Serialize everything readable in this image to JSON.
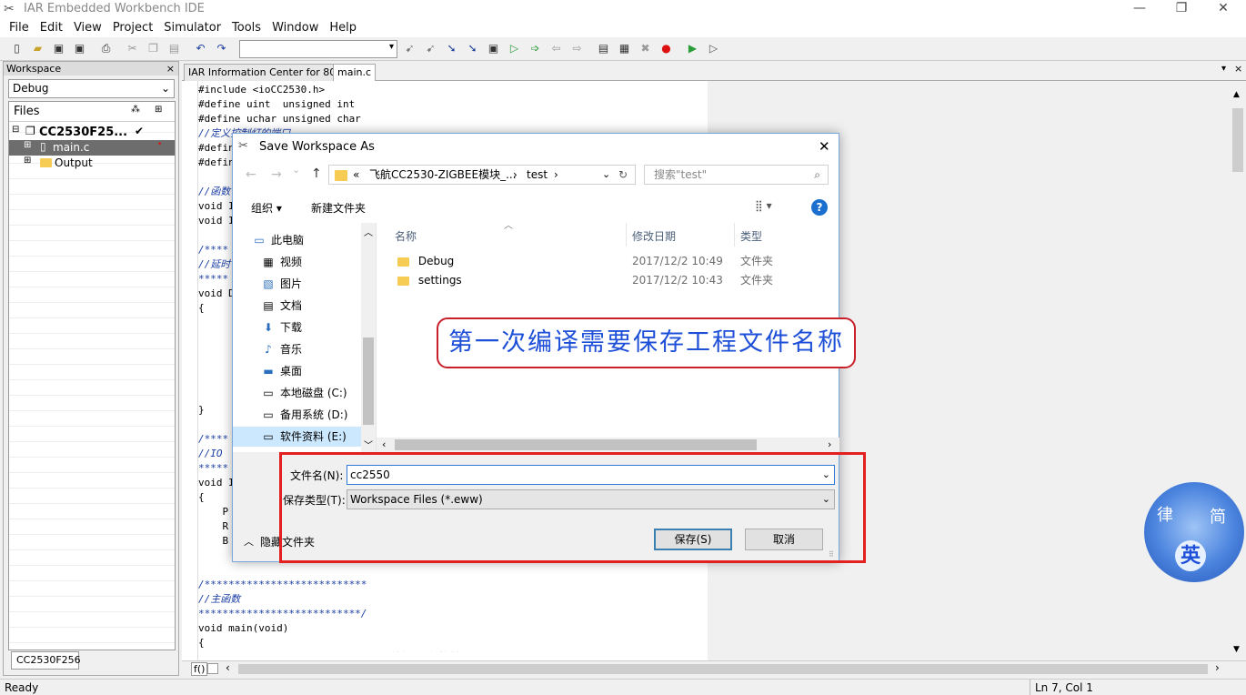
{
  "app": {
    "title": "IAR Embedded Workbench IDE",
    "icon": "iar-logo-icon"
  },
  "window_controls": {
    "minimize": "—",
    "restore": "❐",
    "close": "✕"
  },
  "menu": [
    "File",
    "Edit",
    "View",
    "Project",
    "Simulator",
    "Tools",
    "Window",
    "Help"
  ],
  "workspace": {
    "header": "Workspace",
    "close": "×",
    "config": "Debug",
    "files_label": "Files",
    "project": "CC2530F25...",
    "project_check": "✔",
    "items": [
      {
        "label": "main.c"
      },
      {
        "label": "Output"
      }
    ],
    "tab": "CC2530F256"
  },
  "editor": {
    "tabs": [
      "IAR Information Center for 8051",
      "main.c"
    ],
    "code": [
      "#include <ioCC2530.h>",
      "#define uint  unsigned int",
      "#define uchar unsigned char",
      "//定义控制灯的端口",
      "#defin",
      "#defin",
      "",
      "//函数",
      "void I",
      "void I",
      "",
      "/****",
      "//延时",
      "*****",
      "void D",
      "{",
      "",
      "",
      "",
      "",
      "",
      "",
      "}",
      "",
      "/****",
      "//IO",
      "*****",
      "void I",
      "{",
      "    P",
      "    R",
      "    B",
      "",
      "",
      "/***************************",
      "//主函数",
      "***************************/",
      "void main(void)",
      "{",
      "    InitIO();               //初始化LED灯控制IO口"
    ],
    "hscroll_label": "f()"
  },
  "status": {
    "left": "Ready",
    "right": "Ln 7, Col 1"
  },
  "dialog": {
    "title": "Save Workspace As",
    "close": "✕",
    "breadcrumb": [
      "«",
      "飞航CC2530-ZIGBEE模块_...",
      "test"
    ],
    "search_placeholder": "搜索\"test\"",
    "organize": "组织 ▾",
    "new_folder": "新建文件夹",
    "nav": [
      {
        "label": "此电脑",
        "icon": "computer-icon"
      },
      {
        "label": "视频",
        "icon": "video-icon"
      },
      {
        "label": "图片",
        "icon": "picture-icon"
      },
      {
        "label": "文档",
        "icon": "document-icon"
      },
      {
        "label": "下载",
        "icon": "download-icon"
      },
      {
        "label": "音乐",
        "icon": "music-icon"
      },
      {
        "label": "桌面",
        "icon": "desktop-icon"
      },
      {
        "label": "本地磁盘 (C:)",
        "icon": "drive-icon"
      },
      {
        "label": "备用系统 (D:)",
        "icon": "drive-icon"
      },
      {
        "label": "软件资料 (E:)",
        "icon": "drive-icon"
      }
    ],
    "columns": [
      "名称",
      "修改日期",
      "类型"
    ],
    "files": [
      {
        "name": "Debug",
        "date": "2017/12/2 10:49",
        "type": "文件夹"
      },
      {
        "name": "settings",
        "date": "2017/12/2 10:43",
        "type": "文件夹"
      }
    ],
    "filename_label": "文件名(N):",
    "filename_value": "cc2550",
    "filetype_label": "保存类型(T):",
    "filetype_value": "Workspace Files (*.eww)",
    "hide_folders": "隐藏文件夹",
    "save": "保存(S)",
    "cancel": "取消"
  },
  "annotation": {
    "text": "第一次编译需要保存工程文件名称",
    "border_color": "#c8202a",
    "text_color": "#1d4fd8"
  },
  "watermark": {
    "chars": [
      "律",
      "简",
      "英"
    ]
  }
}
